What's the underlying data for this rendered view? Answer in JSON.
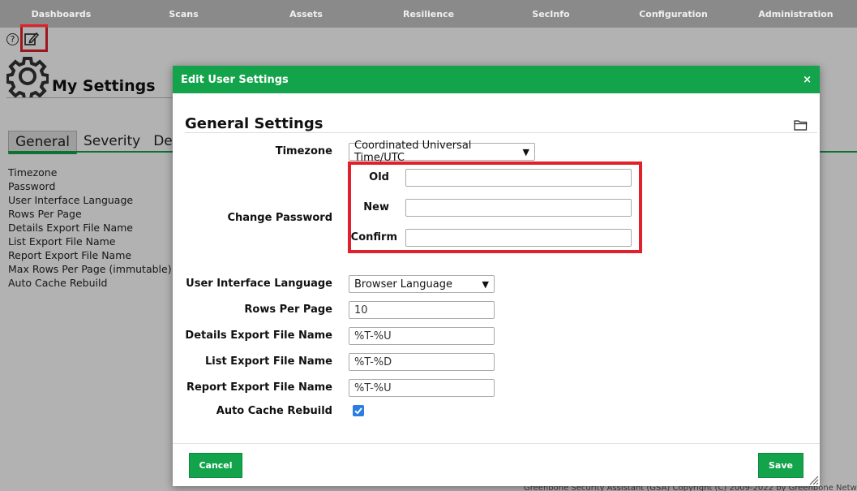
{
  "nav": {
    "items": [
      "Dashboards",
      "Scans",
      "Assets",
      "Resilience",
      "SecInfo",
      "Configuration",
      "Administration"
    ]
  },
  "page": {
    "help_glyph": "?",
    "title": "My Settings",
    "tabs": [
      "General",
      "Severity",
      "Def"
    ],
    "settings_list": [
      "Timezone",
      "Password",
      "User Interface Language",
      "Rows Per Page",
      "Details Export File Name",
      "List Export File Name",
      "Report Export File Name",
      "Max Rows Per Page (immutable)",
      "Auto Cache Rebuild"
    ],
    "footer": "Greenbone Security Assistant (GSA) Copyright (C) 2009-2022 by Greenbone Netw"
  },
  "modal": {
    "title": "Edit User Settings",
    "close": "×",
    "section_title": "General Settings",
    "timezone": {
      "label": "Timezone",
      "value": "Coordinated Universal Time/UTC"
    },
    "password": {
      "label": "Change Password",
      "old_label": "Old",
      "new_label": "New",
      "confirm_label": "Confirm",
      "old_value": "",
      "new_value": "",
      "confirm_value": ""
    },
    "language": {
      "label": "User Interface Language",
      "value": "Browser Language"
    },
    "rows_per_page": {
      "label": "Rows Per Page",
      "value": "10"
    },
    "details_export": {
      "label": "Details Export File Name",
      "value": "%T-%U"
    },
    "list_export": {
      "label": "List Export File Name",
      "value": "%T-%D"
    },
    "report_export": {
      "label": "Report Export File Name",
      "value": "%T-%U"
    },
    "auto_cache": {
      "label": "Auto Cache Rebuild",
      "checked": true
    },
    "cancel_label": "Cancel",
    "save_label": "Save"
  },
  "colors": {
    "accent": "#13a34b",
    "highlight": "#e0202a",
    "checkbox": "#2a7de1"
  }
}
